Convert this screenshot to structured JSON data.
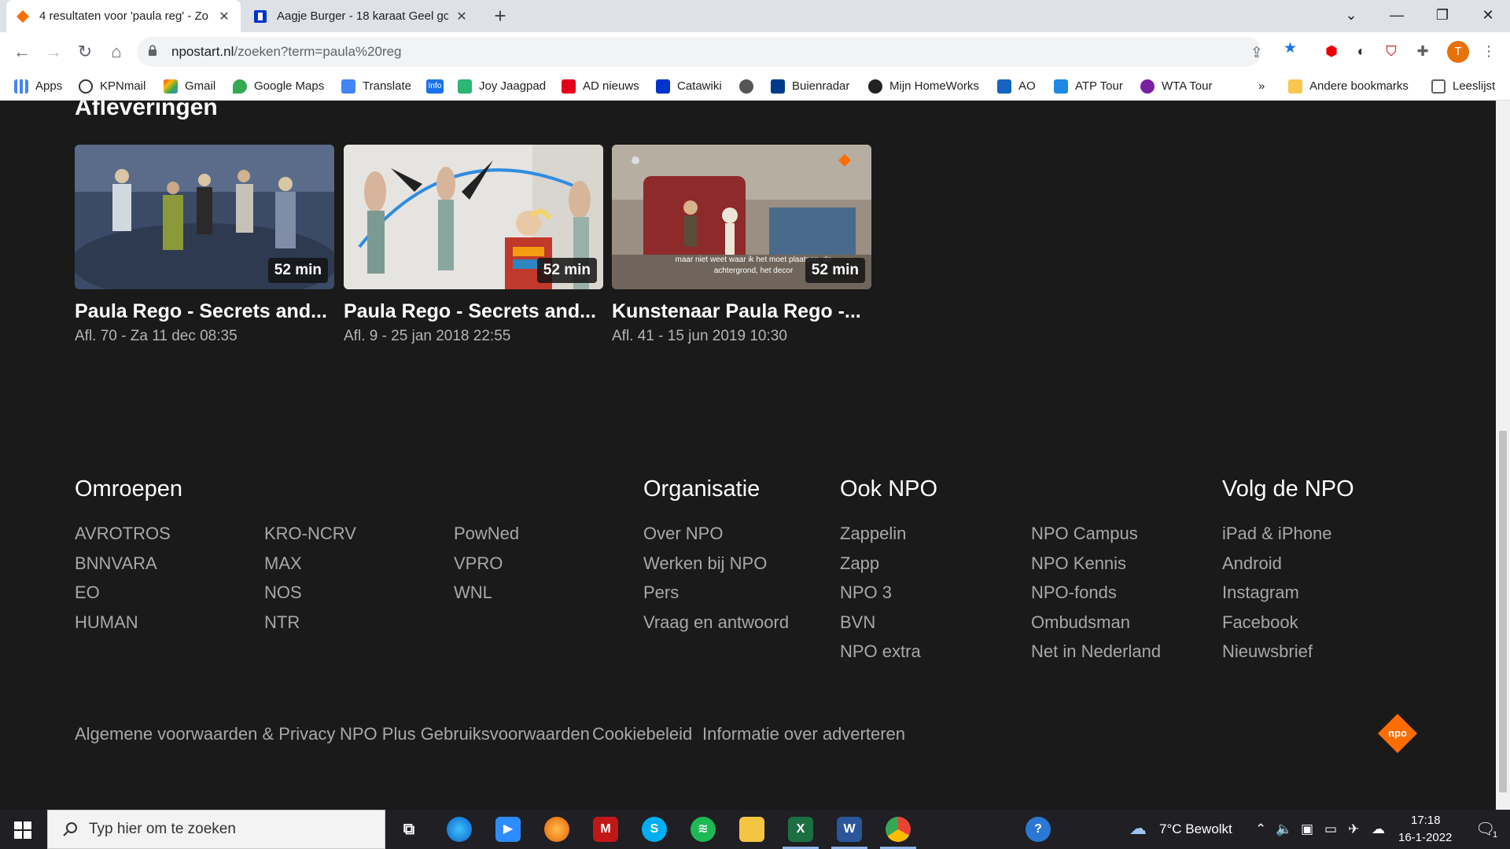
{
  "browser": {
    "tabs": [
      {
        "title": "4 resultaten voor 'paula reg' - Zo",
        "active": true
      },
      {
        "title": "Aagje Burger - 18 karaat Geel go",
        "active": false
      }
    ],
    "url_host": "npostart.nl",
    "url_path": "/zoeken?term=paula%20reg",
    "profile_initial": "T"
  },
  "bookmarks": {
    "items": [
      "Apps",
      "KPNmail",
      "Gmail",
      "Google Maps",
      "Translate",
      "Info",
      "Joy Jaagpad",
      "AD nieuws",
      "Catawiki",
      "Buienradar",
      "Mijn HomeWorks",
      "AO",
      "ATP Tour",
      "WTA Tour"
    ],
    "overflow": "»",
    "other_bookmarks": "Andere bookmarks",
    "reading_list": "Leeslijst"
  },
  "episodes": {
    "heading": "Afleveringen",
    "cards": [
      {
        "title": "Paula Rego - Secrets and...",
        "subtitle": "Afl. 70 - Za 11 dec 08:35",
        "duration": "52 min"
      },
      {
        "title": "Paula Rego - Secrets and...",
        "subtitle": "Afl. 9 - 25 jan 2018 22:55",
        "duration": "52 min"
      },
      {
        "title": "Kunstenaar Paula Rego -...",
        "subtitle": "Afl. 41 - 15 jun 2019 10:30",
        "duration": "52 min",
        "caption": "maar niet weet waar ik het moet plaatsen, de achtergrond, het decor"
      }
    ]
  },
  "footer": {
    "omroepen": {
      "heading": "Omroepen",
      "col1": [
        "AVROTROS",
        "BNNVARA",
        "EO",
        "HUMAN"
      ],
      "col2": [
        "KRO-NCRV",
        "MAX",
        "NOS",
        "NTR"
      ],
      "col3": [
        "PowNed",
        "VPRO",
        "WNL"
      ]
    },
    "organisatie": {
      "heading": "Organisatie",
      "links": [
        "Over NPO",
        "Werken bij NPO",
        "Pers",
        "Vraag en antwoord"
      ]
    },
    "ook_npo": {
      "heading": "Ook NPO",
      "col1": [
        "Zappelin",
        "Zapp",
        "NPO 3",
        "BVN",
        "NPO extra"
      ],
      "col2": [
        "NPO Campus",
        "NPO Kennis",
        "NPO-fonds",
        "Ombudsman",
        "Net in Nederland"
      ]
    },
    "volg": {
      "heading": "Volg de NPO",
      "links": [
        "iPad & iPhone",
        "Android",
        "Instagram",
        "Facebook",
        "Nieuwsbrief"
      ]
    },
    "legal": [
      "Algemene voorwaarden & Privacy",
      "NPO Plus Gebruiksvoorwaarden",
      "Cookiebeleid",
      "Informatie over adverteren"
    ],
    "logo_text": "npo"
  },
  "taskbar": {
    "search_placeholder": "Typ hier om te zoeken",
    "weather": "7°C  Bewolkt",
    "time": "17:18",
    "date": "16-1-2022",
    "notification_count": "1"
  },
  "colors": {
    "page_bg": "#1a1a1a",
    "npo_orange": "#ff6d00",
    "link_gray": "#a8a8a8"
  }
}
